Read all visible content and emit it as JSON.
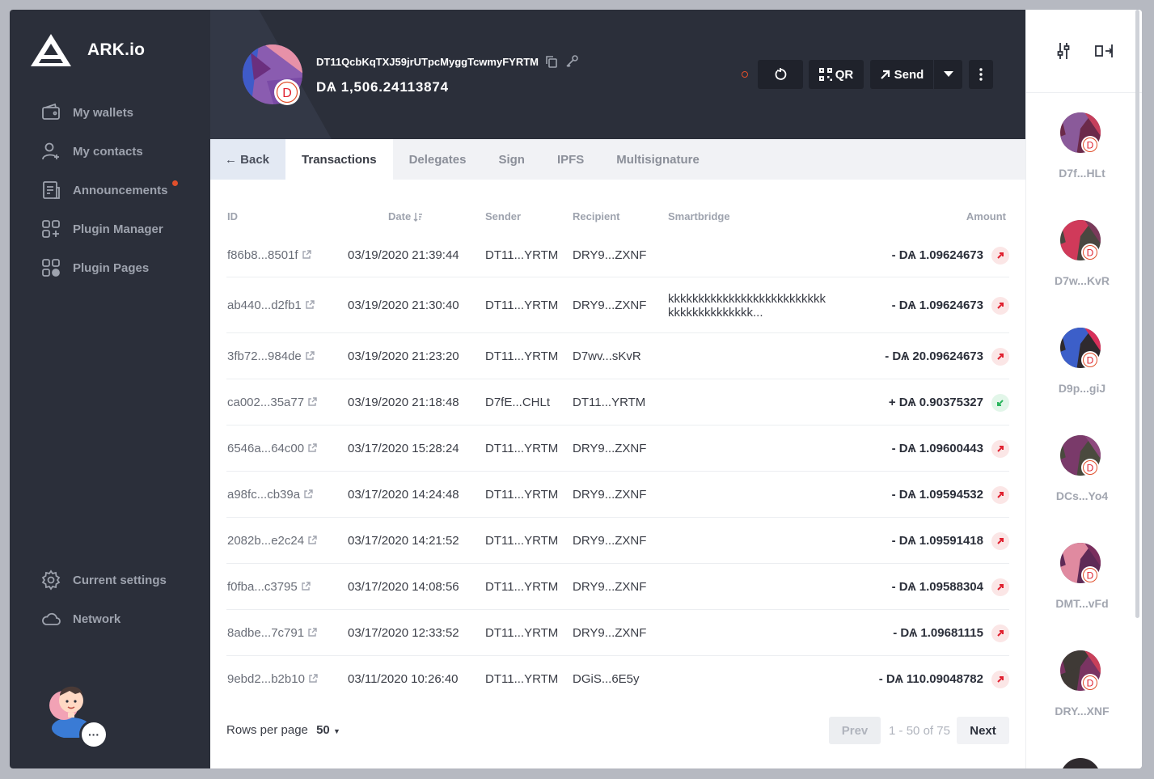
{
  "app": {
    "name": "ARK.io"
  },
  "sidebar": {
    "items": [
      {
        "label": "My wallets",
        "icon": "wallet-icon"
      },
      {
        "label": "My contacts",
        "icon": "contact-icon"
      },
      {
        "label": "Announcements",
        "icon": "announcement-icon",
        "has_notification": true
      },
      {
        "label": "Plugin Manager",
        "icon": "plugin-manager-icon"
      },
      {
        "label": "Plugin Pages",
        "icon": "plugin-pages-icon"
      }
    ],
    "bottom_items": [
      {
        "label": "Current settings",
        "icon": "gear-icon"
      },
      {
        "label": "Network",
        "icon": "cloud-icon"
      }
    ],
    "more_label": "···"
  },
  "wallet": {
    "address": "DT11QcbKqTXJ59jrUTpcMyggTcwmyFYRTM",
    "balance": "DѦ 1,506.24113874",
    "avatar_letter": "D"
  },
  "toolbar": {
    "qr_label": "QR",
    "send_label": "Send"
  },
  "tabs": [
    {
      "label": "← Back"
    },
    {
      "label": "Transactions"
    },
    {
      "label": "Delegates"
    },
    {
      "label": "Sign"
    },
    {
      "label": "IPFS"
    },
    {
      "label": "Multisignature"
    }
  ],
  "table": {
    "headers": {
      "id": "ID",
      "date": "Date",
      "sender": "Sender",
      "recipient": "Recipient",
      "smartbridge": "Smartbridge",
      "amount": "Amount"
    },
    "rows": [
      {
        "id": "f86b8...8501f",
        "date": "03/19/2020 21:39:44",
        "sender": "DT11...YRTM",
        "recipient": "DRY9...ZXNF",
        "smartbridge": "",
        "amount": "- DѦ 1.09624673",
        "direction": "out"
      },
      {
        "id": "ab440...d2fb1",
        "date": "03/19/2020 21:30:40",
        "sender": "DT11...YRTM",
        "recipient": "DRY9...ZXNF",
        "smartbridge": "kkkkkkkkkkkkkkkkkkkkkkkkkk kkkkkkkkkkkkkk...",
        "amount": "- DѦ 1.09624673",
        "direction": "out"
      },
      {
        "id": "3fb72...984de",
        "date": "03/19/2020 21:23:20",
        "sender": "DT11...YRTM",
        "recipient": "D7wv...sKvR",
        "smartbridge": "",
        "amount": "- DѦ 20.09624673",
        "direction": "out"
      },
      {
        "id": "ca002...35a77",
        "date": "03/19/2020 21:18:48",
        "sender": "D7fE...CHLt",
        "recipient": "DT11...YRTM",
        "smartbridge": "",
        "amount": "+ DѦ 0.90375327",
        "direction": "in"
      },
      {
        "id": "6546a...64c00",
        "date": "03/17/2020 15:28:24",
        "sender": "DT11...YRTM",
        "recipient": "DRY9...ZXNF",
        "smartbridge": "",
        "amount": "- DѦ 1.09600443",
        "direction": "out"
      },
      {
        "id": "a98fc...cb39a",
        "date": "03/17/2020 14:24:48",
        "sender": "DT11...YRTM",
        "recipient": "DRY9...ZXNF",
        "smartbridge": "",
        "amount": "- DѦ 1.09594532",
        "direction": "out"
      },
      {
        "id": "2082b...e2c24",
        "date": "03/17/2020 14:21:52",
        "sender": "DT11...YRTM",
        "recipient": "DRY9...ZXNF",
        "smartbridge": "",
        "amount": "- DѦ 1.09591418",
        "direction": "out"
      },
      {
        "id": "f0fba...c3795",
        "date": "03/17/2020 14:08:56",
        "sender": "DT11...YRTM",
        "recipient": "DRY9...ZXNF",
        "smartbridge": "",
        "amount": "- DѦ 1.09588304",
        "direction": "out"
      },
      {
        "id": "8adbe...7c791",
        "date": "03/17/2020 12:33:52",
        "sender": "DT11...YRTM",
        "recipient": "DRY9...ZXNF",
        "smartbridge": "",
        "amount": "- DѦ 1.09681115",
        "direction": "out"
      },
      {
        "id": "9ebd2...b2b10",
        "date": "03/11/2020 10:26:40",
        "sender": "DT11...YRTM",
        "recipient": "DGiS...6E5y",
        "smartbridge": "",
        "amount": "- DѦ 110.09048782",
        "direction": "out"
      }
    ]
  },
  "pagination": {
    "rows_per_page_label": "Rows per page",
    "rows_per_page_value": "50",
    "prev_label": "Prev",
    "range_label": "1 - 50 of 75",
    "next_label": "Next"
  },
  "right_panel": {
    "wallets": [
      {
        "name": "D7f...HLt",
        "letter": "D",
        "c1": "#6b2a4a",
        "c2": "#8a5a9a",
        "c3": "#c43f5c"
      },
      {
        "name": "D7w...KvR",
        "letter": "D",
        "c1": "#4a4740",
        "c2": "#d03a5a",
        "c3": "#7a3a5a"
      },
      {
        "name": "D9p...giJ",
        "letter": "D",
        "c1": "#2f2a2e",
        "c2": "#3c5fc9",
        "c3": "#d8305a"
      },
      {
        "name": "DCs...Yo4",
        "letter": "D",
        "c1": "#4a4a3e",
        "c2": "#7a3a6a",
        "c3": "#8e4a7e"
      },
      {
        "name": "DMT...vFd",
        "letter": "D",
        "c1": "#5e2a56",
        "c2": "#e08aa0",
        "c3": "#7a2f5e"
      },
      {
        "name": "DRY...XNF",
        "letter": "D",
        "c1": "#7a3462",
        "c2": "#3f3a36",
        "c3": "#c8405a"
      }
    ]
  },
  "colors": {
    "sidebar_bg": "#2b2f3a",
    "accent_red": "#e0202f",
    "accent_green": "#2ab55d"
  }
}
